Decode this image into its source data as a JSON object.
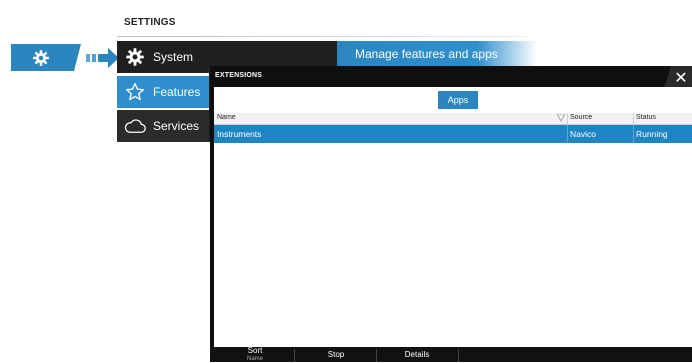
{
  "settings": {
    "title": "SETTINGS",
    "categories": [
      {
        "label": "System",
        "icon": "gear-icon"
      },
      {
        "label": "Features",
        "icon": "star-icon"
      },
      {
        "label": "Services",
        "icon": "cloud-icon"
      }
    ],
    "manage_label": "Manage features and apps"
  },
  "extensions": {
    "title": "EXTENSIONS",
    "close_glyph": "✕",
    "tabs": [
      {
        "label": "Apps"
      }
    ],
    "columns": [
      "Name",
      "Source",
      "Status"
    ],
    "rows": [
      {
        "name": "Instruments",
        "source": "Navico",
        "status": "Running"
      }
    ],
    "footer": {
      "sort_label": "Sort",
      "sort_value": "Name",
      "stop_label": "Stop",
      "details_label": "Details"
    }
  },
  "colors": {
    "accent": "#2b86c0",
    "selected_row": "#1d85c4",
    "panel_dark": "#1c1c1c"
  }
}
